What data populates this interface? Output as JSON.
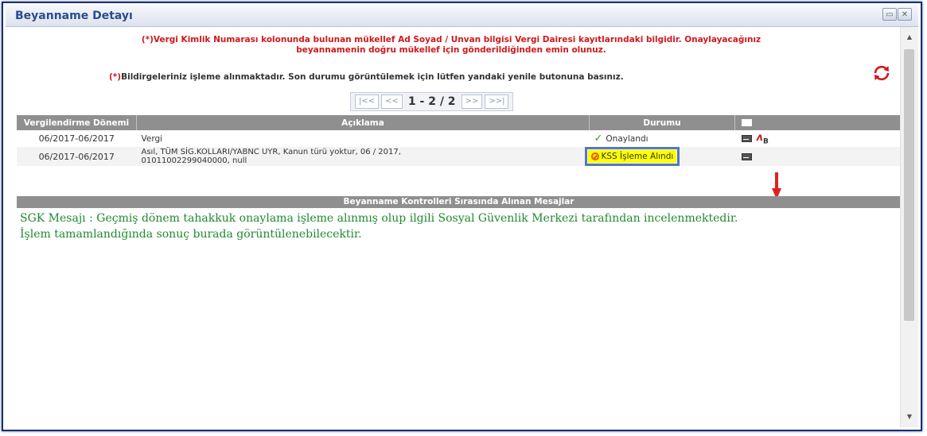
{
  "window": {
    "title": "Beyanname Detayı",
    "buttons": [
      "restore",
      "close"
    ]
  },
  "warning": {
    "line1": "(*)Vergi Kimlik Numarası kolonunda bulunan mükellef Ad Soyad / Unvan bilgisi Vergi Dairesi kayıtlarındaki bilgidir. Onaylayacağınız",
    "line2": "beyannamenin doğru mükellef için gönderildiğinden emin olunuz."
  },
  "notice": {
    "star": "(*)",
    "text": "Bildirgeleriniz işleme alınmaktadır. Son durumu görüntülemek için lütfen yandaki yenile butonuna basınız."
  },
  "pager": {
    "first": "|<<",
    "prev": "<<",
    "info": "1 - 2 / 2",
    "next": ">>",
    "last": ">>|"
  },
  "table": {
    "headers": [
      "Vergilendirme Dönemi",
      "Açıklama",
      "Durumu",
      ""
    ],
    "rows": [
      {
        "period": "06/2017-06/2017",
        "desc": "Vergi",
        "status": "Onaylandı",
        "status_icon": "check-icon"
      },
      {
        "period": "06/2017-06/2017",
        "desc1": "Asıl, TÜM SİG.KOLLARI/YABNC UYR, Kanun türü yoktur, 06 / 2017,",
        "desc2": "01011002299040000, null",
        "status": "KSS İşleme Alındı",
        "status_icon": "no-entry-icon"
      }
    ]
  },
  "messages": {
    "header": "Beyanname Kontrolleri Sırasında Alınan Mesajlar",
    "line1": "SGK Mesajı : Geçmiş dönem tahakkuk onaylama işleme alınmış olup ilgili Sosyal Güvenlik Merkezi tarafından incelenmektedir.",
    "line2": "İşlem tamamlandığında sonuç burada görüntülenebilecektir."
  },
  "colors": {
    "warning": "#d1181e",
    "message": "#1f8a2f",
    "highlight": "#ffff00",
    "annotation": "#5579b8",
    "arrow": "#e02020"
  }
}
